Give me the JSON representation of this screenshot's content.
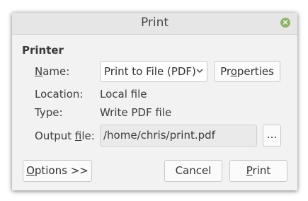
{
  "window": {
    "title": "Print",
    "close_icon": "close-icon"
  },
  "printer_section": {
    "title": "Printer",
    "name_label": "Name:",
    "name_value": "Print to File (PDF)",
    "properties_button": "Properties",
    "location_label": "Location:",
    "location_value": "Local file",
    "type_label": "Type:",
    "type_value": "Write PDF file",
    "output_label": "Output file:",
    "output_value": "/home/chris/print.pdf",
    "browse_button": "..."
  },
  "actions": {
    "options_button": "Options >>",
    "cancel_button": "Cancel",
    "print_button": "Print"
  },
  "colors": {
    "close_button": "#8fb56a",
    "dialog_bg": "#f2f2f2",
    "titlebar_bg": "#e6e6e6"
  }
}
